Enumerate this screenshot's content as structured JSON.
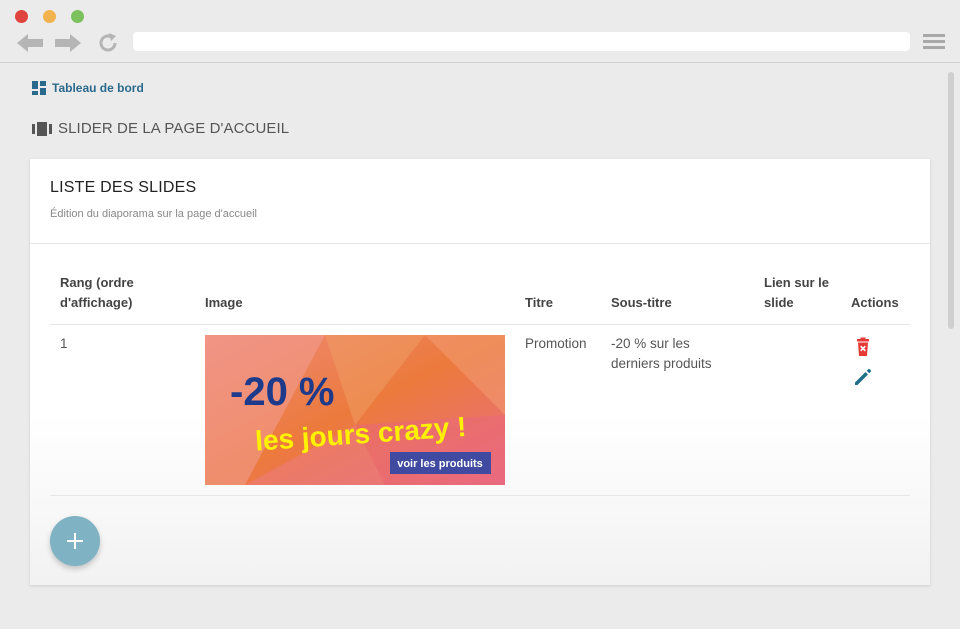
{
  "breadcrumb": {
    "label": "Tableau de bord",
    "icon": "dashboard-icon"
  },
  "page": {
    "title": "SLIDER DE LA PAGE D'ACCUEIL",
    "icon": "slider-icon"
  },
  "card": {
    "title": "LISTE DES SLIDES",
    "subtitle": "Édition du diaporama sur la page d'accueil"
  },
  "table": {
    "headers": {
      "rank_line1": "Rang (ordre",
      "rank_line2": "d'affichage)",
      "image": "Image",
      "title": "Titre",
      "subtitle": "Sous-titre",
      "link_line1": "Lien sur le",
      "link_line2": "slide",
      "actions": "Actions"
    },
    "rows": [
      {
        "rank": "1",
        "title": "Promotion",
        "subtitle_line1": "-20 % sur les",
        "subtitle_line2": "derniers produits",
        "link": "",
        "image": {
          "headline": "-20 %",
          "tagline": "les jours crazy !",
          "button": "voir les produits"
        }
      }
    ]
  },
  "icons": {
    "delete": "trash-icon",
    "edit": "pencil-icon",
    "add": "plus-icon"
  },
  "colors": {
    "accent": "#2b6a8c",
    "delete": "#e53935",
    "edit": "#1f6f8b",
    "fab": "#7fb2c2"
  }
}
